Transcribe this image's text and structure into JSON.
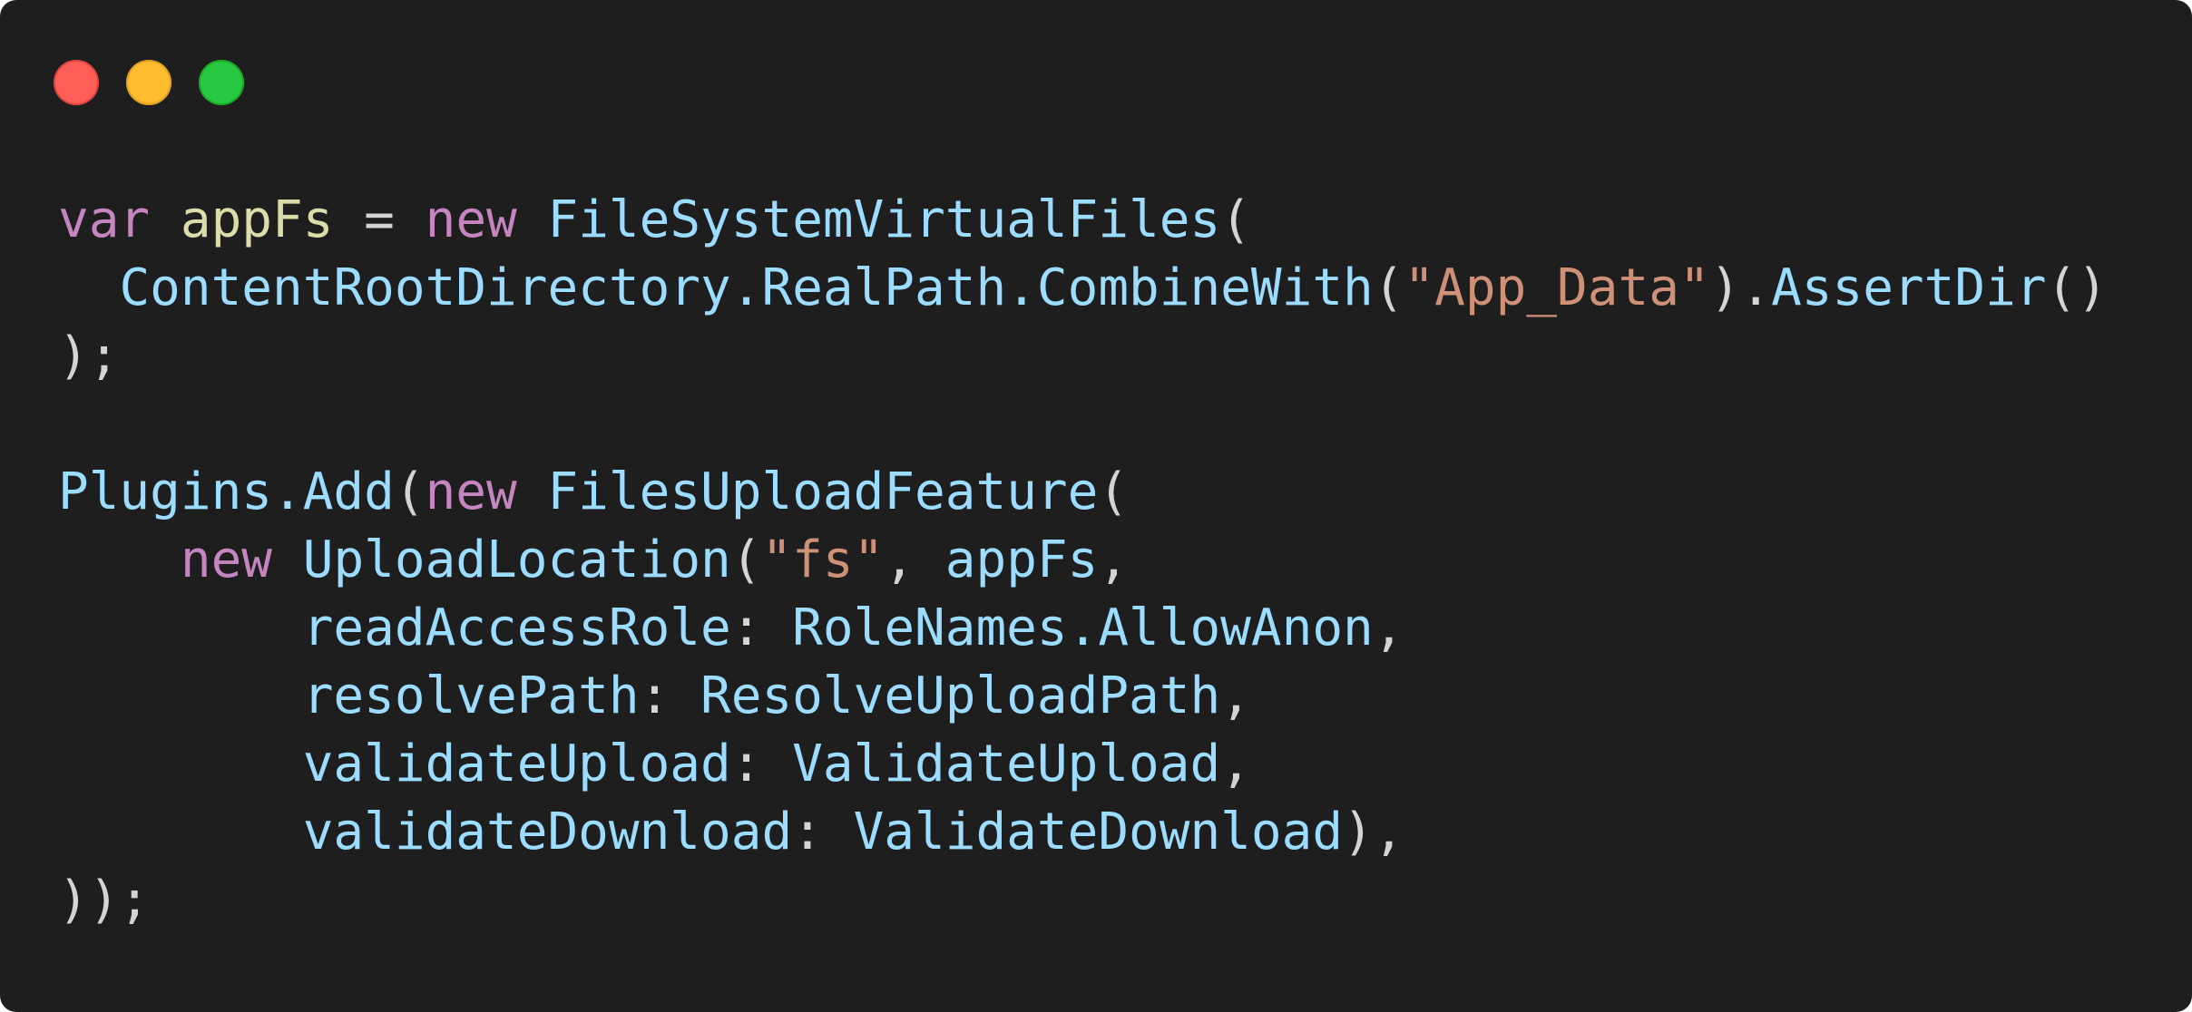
{
  "window": {
    "controls": [
      {
        "name": "close",
        "color": "#ff5f57"
      },
      {
        "name": "minimize",
        "color": "#febc2e"
      },
      {
        "name": "zoom",
        "color": "#28c840"
      }
    ]
  },
  "code": {
    "lines": [
      [
        {
          "t": "var",
          "c": "kw"
        },
        {
          "t": " ",
          "c": "punc"
        },
        {
          "t": "appFs",
          "c": "var"
        },
        {
          "t": " = ",
          "c": "punc"
        },
        {
          "t": "new",
          "c": "kw"
        },
        {
          "t": " ",
          "c": "punc"
        },
        {
          "t": "FileSystemVirtualFiles",
          "c": "ident"
        },
        {
          "t": "(",
          "c": "punc"
        }
      ],
      [
        {
          "t": "  ",
          "c": "punc"
        },
        {
          "t": "ContentRootDirectory.RealPath.CombineWith",
          "c": "ident"
        },
        {
          "t": "(",
          "c": "punc"
        },
        {
          "t": "\"App_Data\"",
          "c": "str"
        },
        {
          "t": ").",
          "c": "punc"
        },
        {
          "t": "AssertDir",
          "c": "ident"
        },
        {
          "t": "()",
          "c": "punc"
        }
      ],
      [
        {
          "t": ");",
          "c": "punc"
        }
      ],
      [],
      [
        {
          "t": "Plugins.Add",
          "c": "ident"
        },
        {
          "t": "(",
          "c": "punc"
        },
        {
          "t": "new",
          "c": "kw"
        },
        {
          "t": " ",
          "c": "punc"
        },
        {
          "t": "FilesUploadFeature",
          "c": "ident"
        },
        {
          "t": "(",
          "c": "punc"
        }
      ],
      [
        {
          "t": "    ",
          "c": "punc"
        },
        {
          "t": "new",
          "c": "kw"
        },
        {
          "t": " ",
          "c": "punc"
        },
        {
          "t": "UploadLocation",
          "c": "ident"
        },
        {
          "t": "(",
          "c": "punc"
        },
        {
          "t": "\"fs\"",
          "c": "str"
        },
        {
          "t": ", ",
          "c": "punc"
        },
        {
          "t": "appFs",
          "c": "ident"
        },
        {
          "t": ",",
          "c": "punc"
        }
      ],
      [
        {
          "t": "        ",
          "c": "punc"
        },
        {
          "t": "readAccessRole",
          "c": "ident"
        },
        {
          "t": ": ",
          "c": "punc"
        },
        {
          "t": "RoleNames.AllowAnon",
          "c": "ident"
        },
        {
          "t": ",",
          "c": "punc"
        }
      ],
      [
        {
          "t": "        ",
          "c": "punc"
        },
        {
          "t": "resolvePath",
          "c": "ident"
        },
        {
          "t": ": ",
          "c": "punc"
        },
        {
          "t": "ResolveUploadPath",
          "c": "ident"
        },
        {
          "t": ",",
          "c": "punc"
        }
      ],
      [
        {
          "t": "        ",
          "c": "punc"
        },
        {
          "t": "validateUpload",
          "c": "ident"
        },
        {
          "t": ": ",
          "c": "punc"
        },
        {
          "t": "ValidateUpload",
          "c": "ident"
        },
        {
          "t": ",",
          "c": "punc"
        }
      ],
      [
        {
          "t": "        ",
          "c": "punc"
        },
        {
          "t": "validateDownload",
          "c": "ident"
        },
        {
          "t": ": ",
          "c": "punc"
        },
        {
          "t": "ValidateDownload",
          "c": "ident"
        },
        {
          "t": "),",
          "c": "punc"
        }
      ],
      [
        {
          "t": "));",
          "c": "punc"
        }
      ]
    ]
  }
}
